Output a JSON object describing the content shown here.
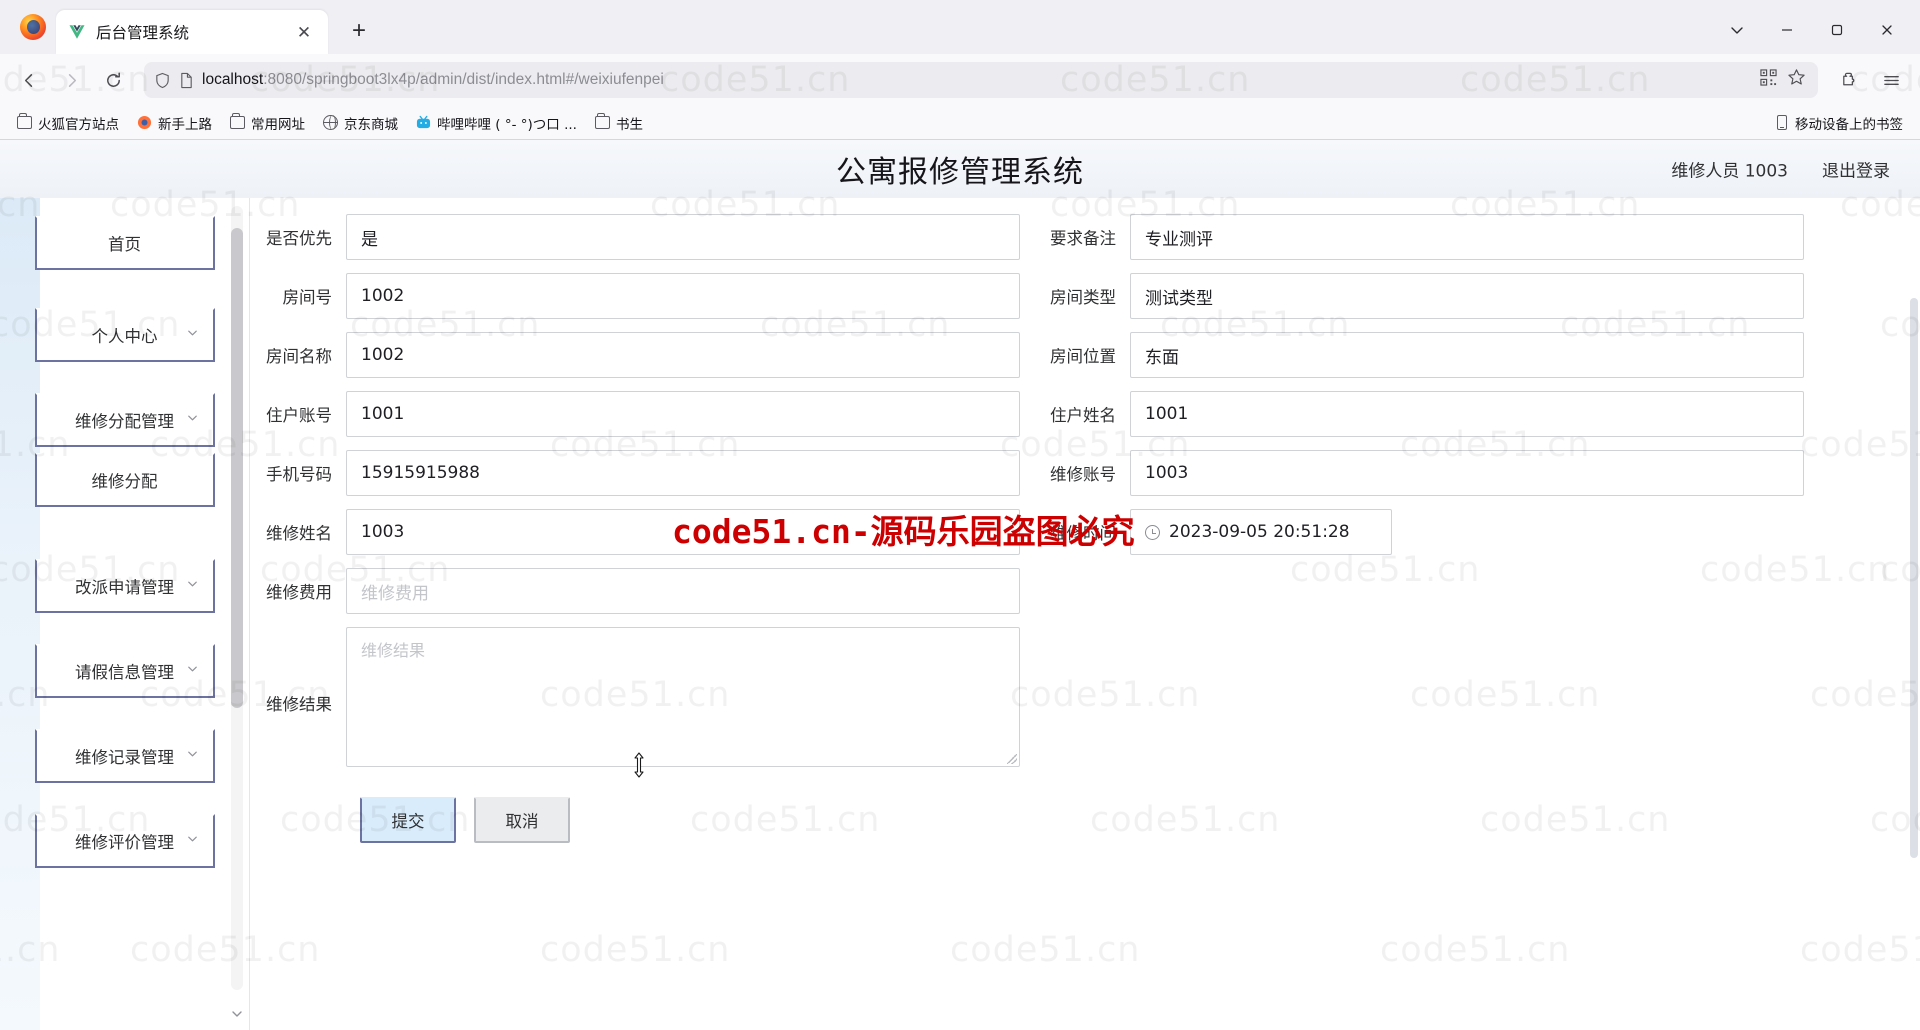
{
  "browser": {
    "tab": {
      "title": "后台管理系统",
      "icon": "vue-icon",
      "close_label": "✕"
    },
    "newtab_label": "+",
    "window_controls": {
      "list": "chevron-down-icon",
      "minimize": "—",
      "maximize": "□",
      "close": "✕"
    },
    "nav": {
      "back": "←",
      "forward": "→",
      "reload": "⟳"
    },
    "url": {
      "host": "localhost",
      "rest": ":8080/springboot3lx4p/admin/dist/index.html#/weixiufenpei"
    },
    "url_icons": [
      "shield-icon",
      "page-file-icon",
      "qr-code-icon",
      "bookmark-star-icon",
      "extensions-icon",
      "app-menu-icon"
    ],
    "bookmarks": [
      {
        "label": "火狐官方站点",
        "icon": "folder-icon"
      },
      {
        "label": "新手上路",
        "icon": "firefox-icon"
      },
      {
        "label": "常用网址",
        "icon": "folder-icon"
      },
      {
        "label": "京东商城",
        "icon": "globe-icon"
      },
      {
        "label": "哔哩哔哩 ( °- °)つ口 ...",
        "icon": "bilibili-icon"
      },
      {
        "label": "书生",
        "icon": "folder-icon"
      }
    ],
    "bookmarks_right": {
      "label": "移动设备上的书签",
      "icon": "mobile-icon"
    }
  },
  "app": {
    "title": "公寓报修管理系统",
    "user": "维修人员 1003",
    "logout": "退出登录",
    "sidebar": [
      {
        "label": "首页",
        "expandable": false
      },
      {
        "label": "个人中心",
        "expandable": true
      },
      {
        "label": "维修分配管理",
        "expandable": true
      },
      {
        "label": "维修分配",
        "expandable": false,
        "child": true
      },
      {
        "label": "改派申请管理",
        "expandable": true
      },
      {
        "label": "请假信息管理",
        "expandable": true
      },
      {
        "label": "维修记录管理",
        "expandable": true
      },
      {
        "label": "维修评价管理",
        "expandable": true
      }
    ],
    "form": {
      "rows": [
        {
          "left": {
            "label": "是否优先",
            "value": "是",
            "placeholder": ""
          },
          "right": {
            "label": "要求备注",
            "value": "专业测评",
            "placeholder": ""
          }
        },
        {
          "left": {
            "label": "房间号",
            "value": "1002",
            "placeholder": ""
          },
          "right": {
            "label": "房间类型",
            "value": "测试类型",
            "placeholder": ""
          }
        },
        {
          "left": {
            "label": "房间名称",
            "value": "1002",
            "placeholder": ""
          },
          "right": {
            "label": "房间位置",
            "value": "东面",
            "placeholder": ""
          }
        },
        {
          "left": {
            "label": "住户账号",
            "value": "1001",
            "placeholder": ""
          },
          "right": {
            "label": "住户姓名",
            "value": "1001",
            "placeholder": ""
          }
        },
        {
          "left": {
            "label": "手机号码",
            "value": "15915915988",
            "placeholder": ""
          },
          "right": {
            "label": "维修账号",
            "value": "1003",
            "placeholder": ""
          }
        },
        {
          "left": {
            "label": "维修姓名",
            "value": "1003",
            "placeholder": ""
          },
          "right": {
            "label": "维修时间",
            "value": "2023-09-05 20:51:28",
            "placeholder": "",
            "icon": "clock-icon"
          }
        }
      ],
      "fee": {
        "label": "维修费用",
        "value": "",
        "placeholder": "维修费用"
      },
      "result": {
        "label": "维修结果",
        "value": "",
        "placeholder": "维修结果"
      },
      "submit": "提交",
      "cancel": "取消"
    }
  },
  "watermark": {
    "text": "code51.cn",
    "red": "code51.cn-源码乐园盗图必究",
    "red_color": "#cc0000"
  }
}
